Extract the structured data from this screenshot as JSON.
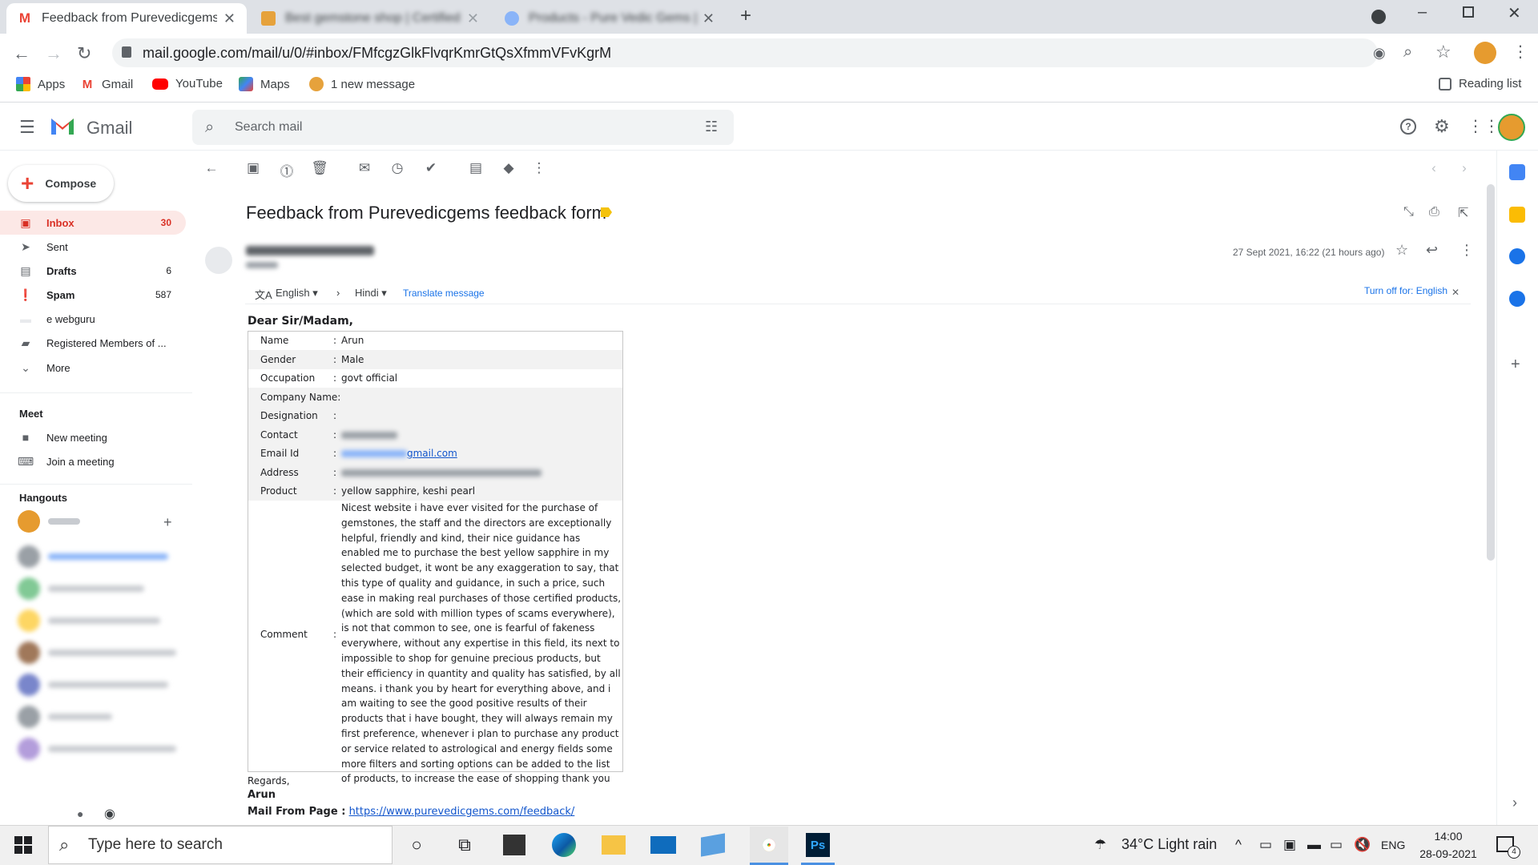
{
  "browser": {
    "tabs": [
      {
        "title": "Feedback from Purevedicgems fe",
        "active": true,
        "favicon": "gmail-favicon-icon"
      },
      {
        "title": "Best gemstone shop | Certified",
        "active": false,
        "favicon": "shop-favicon-icon"
      },
      {
        "title": "Products - Pure Vedic Gems | A",
        "active": false,
        "favicon": "globe-favicon-icon"
      }
    ],
    "url": "mail.google.com/mail/u/0/#inbox/FMfcgzGlkFlvqrKmrGtQsXfmmVFvKgrM",
    "bookmarks": [
      {
        "label": "Apps",
        "icon": "apps-grid-icon"
      },
      {
        "label": "Gmail",
        "icon": "gmail-icon"
      },
      {
        "label": "YouTube",
        "icon": "youtube-icon"
      },
      {
        "label": "Maps",
        "icon": "maps-icon"
      },
      {
        "label": "1 new message",
        "icon": "bookmark-favicon-icon"
      }
    ],
    "reading_list": "Reading list"
  },
  "gmail": {
    "brand": "Gmail",
    "search_placeholder": "Search mail",
    "compose_label": "Compose",
    "nav": [
      {
        "label": "Inbox",
        "count": "30",
        "icon": "inbox-icon"
      },
      {
        "label": "Sent",
        "count": "",
        "icon": "send-icon"
      },
      {
        "label": "Drafts",
        "count": "6",
        "icon": "draft-icon"
      },
      {
        "label": "Spam",
        "count": "587",
        "icon": "spam-icon"
      },
      {
        "label": "e webguru",
        "count": "",
        "icon": "label-icon"
      },
      {
        "label": "Registered Members of ...",
        "count": "",
        "icon": "label-icon"
      },
      {
        "label": "More",
        "count": "",
        "icon": "chevron-down-icon"
      }
    ],
    "meet": {
      "title": "Meet",
      "items": [
        "New meeting",
        "Join a meeting"
      ]
    },
    "hangouts_title": "Hangouts"
  },
  "message": {
    "subject": "Feedback from Purevedicgems feedback form",
    "date": "27 Sept 2021, 16:22 (21 hours ago)",
    "translate": {
      "from": "English",
      "to": "Hindi",
      "action": "Translate message",
      "turn_off": "Turn off for: English"
    },
    "greeting": "Dear Sir/Madam,",
    "fields": [
      {
        "key": "Name",
        "sep": ":",
        "value": "Arun"
      },
      {
        "key": "Gender",
        "sep": ":",
        "value": "Male"
      },
      {
        "key": "Occupation",
        "sep": ":",
        "value": "govt official"
      },
      {
        "key": "Company Name:",
        "sep": "",
        "value": ""
      },
      {
        "key": "Designation",
        "sep": ":",
        "value": ""
      },
      {
        "key": "Contact",
        "sep": ":",
        "value": ""
      },
      {
        "key": "Email Id",
        "sep": ":",
        "value": "gmail.com"
      },
      {
        "key": "Address",
        "sep": ":",
        "value": ""
      },
      {
        "key": "Product",
        "sep": ":",
        "value": "yellow sapphire, keshi pearl"
      }
    ],
    "comment_key": "Comment",
    "comment": "Nicest website i have ever visited for the purchase of gemstones, the staff and the directors are exceptionally helpful, friendly and kind, their nice guidance has enabled me to purchase the best yellow sapphire in my selected budget, it wont be any exaggeration to say, that this type of quality and guidance, in such a price, such ease in making real purchases of those certified products, (which are sold with million types of scams everywhere), is not that common to see, one is fearful of fakeness everywhere, without any expertise in this field, its next to impossible to shop for genuine precious products, but their efficiency in quantity and quality has satisfied, by all means. i thank you by heart for everything above, and i am waiting to see the good positive results of their products that i have bought, they will always remain my first preference, whenever i plan to purchase any product or service related to astrological and energy fields some more filters and sorting options can be added to the list of products, to increase the ease of shopping thank you",
    "regards": "Regards,",
    "sign_name": "Arun",
    "mail_from_label": "Mail From Page :",
    "mail_from_url": "https://www.purevedicgems.com/feedback/"
  },
  "taskbar": {
    "search_placeholder": "Type here to search",
    "weather": "34°C  Light rain",
    "lang": "ENG",
    "time": "14:00",
    "date": "28-09-2021",
    "notif_count": "4"
  },
  "colors": {
    "accent_red": "#d93025",
    "link_blue": "#1a73e8",
    "important_yellow": "#f4c20d"
  }
}
